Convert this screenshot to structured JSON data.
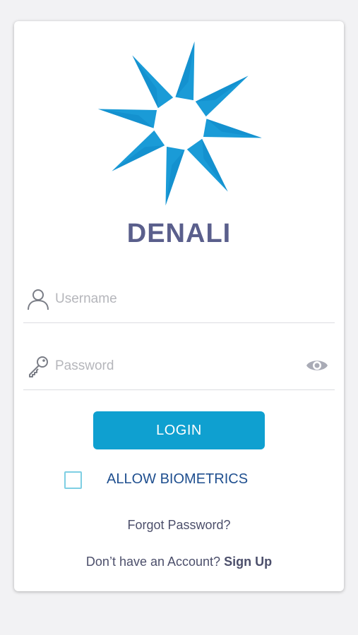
{
  "brand": {
    "name": "DENALI",
    "logo_icon": "compass-star-icon"
  },
  "login_form": {
    "username": {
      "icon": "user-icon",
      "value": "",
      "placeholder": "Username"
    },
    "password": {
      "icon": "key-icon",
      "value": "",
      "placeholder": "Password",
      "toggle_icon": "eye-icon"
    },
    "login_label": "LOGIN",
    "biometrics_label": "ALLOW BIOMETRICS",
    "biometrics_checked": false,
    "forgot_password_label": "Forgot Password?",
    "signup_prompt": "Don’t have an Account?",
    "signup_label": "Sign Up"
  },
  "colors": {
    "accent": "#0fa0d0",
    "logo_blue": "#1a9bd7",
    "brand_text": "#5a5f8c",
    "link_text": "#1f4f8f",
    "muted_text": "#4c4f6b",
    "icon_gray": "#7a7d86"
  }
}
